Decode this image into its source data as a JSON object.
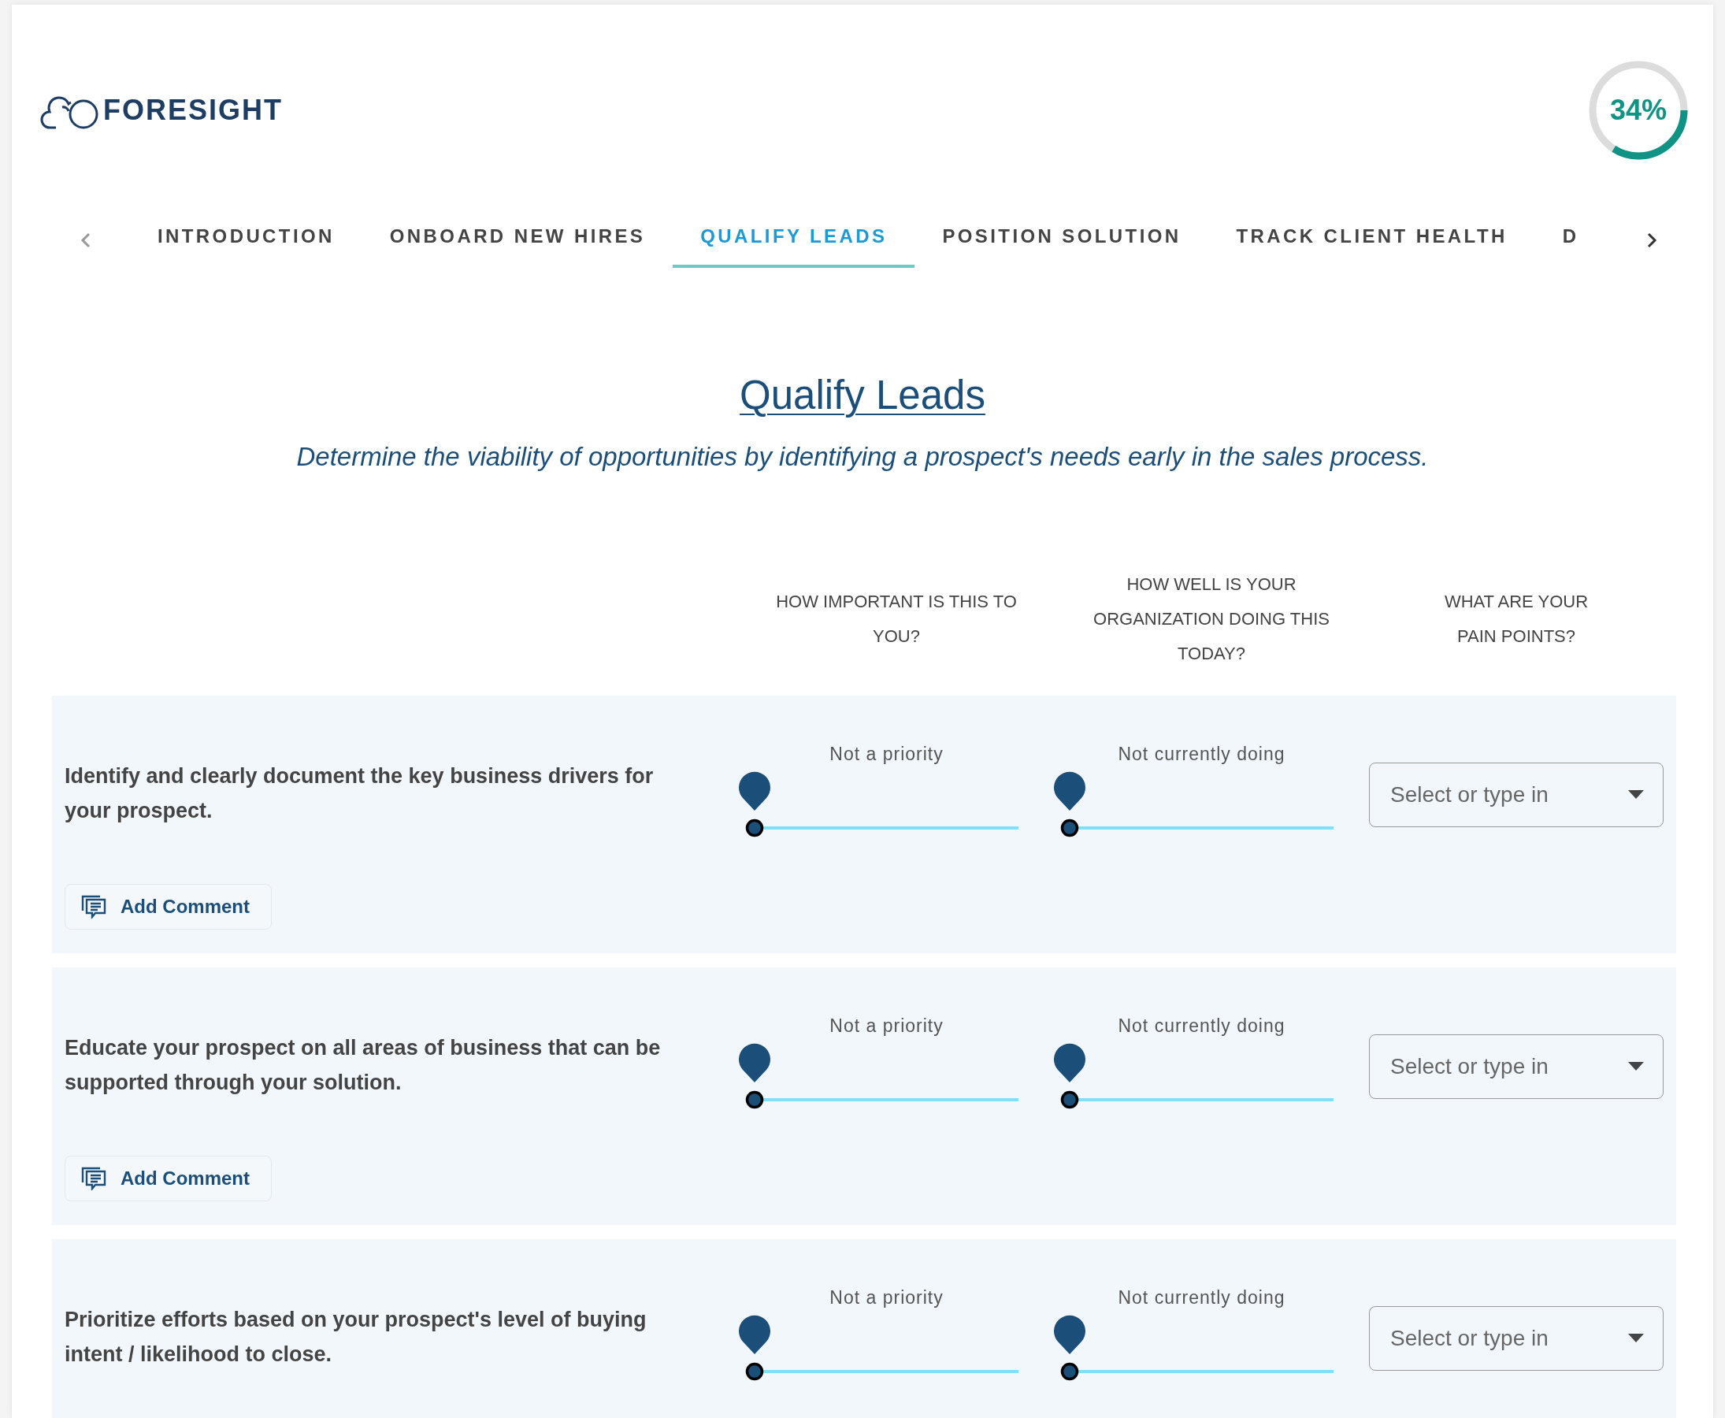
{
  "logo": {
    "text": "FORESIGHT"
  },
  "progress": {
    "text": "34%",
    "level": 0.34
  },
  "tabs": [
    {
      "label": "INTRODUCTION",
      "selected": false
    },
    {
      "label": "ONBOARD NEW HIRES",
      "selected": false
    },
    {
      "label": "QUALIFY LEADS",
      "selected": true
    },
    {
      "label": "POSITION SOLUTION",
      "selected": false
    },
    {
      "label": "TRACK CLIENT HEALTH",
      "selected": false
    },
    {
      "label": "D",
      "selected": false
    }
  ],
  "heading": {
    "title": "Qualify Leads",
    "subtitle": "Determine the viability of opportunities by identifying a prospect's needs early in the sales process."
  },
  "columns": [
    "HOW IMPORTANT IS THIS TO YOU?",
    "HOW WELL IS YOUR ORGANIZATION DOING THIS TODAY?",
    "WHAT ARE YOUR PAIN POINTS?"
  ],
  "rows": [
    {
      "statement": "Identify and clearly document the key business drivers for your prospect.",
      "importance": {
        "label": "Not a priority",
        "level": 0
      },
      "performance": {
        "label": "Not currently doing",
        "level": 0
      },
      "pain_points": {
        "placeholder": "Select or type in"
      },
      "comment_button": "Add Comment"
    },
    {
      "statement": "Educate your prospect on all areas of business that can be supported through your solution.",
      "importance": {
        "label": "Not a priority",
        "level": 0
      },
      "performance": {
        "label": "Not currently doing",
        "level": 0
      },
      "pain_points": {
        "placeholder": "Select or type in"
      },
      "comment_button": "Add Comment"
    },
    {
      "statement": "Prioritize efforts based on your prospect's level of buying intent / likelihood to close.",
      "importance": {
        "label": "Not a priority",
        "level": 0
      },
      "performance": {
        "label": "Not currently doing",
        "level": 0
      },
      "pain_points": {
        "placeholder": "Select or type in"
      }
    }
  ]
}
